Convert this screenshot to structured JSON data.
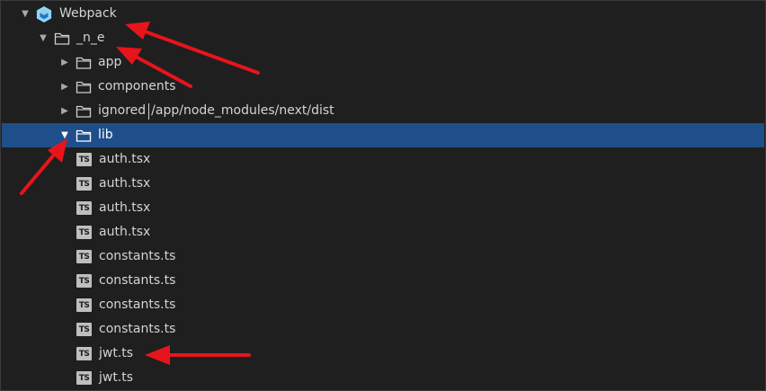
{
  "tree": {
    "root": {
      "label": "Webpack",
      "icon": "webpack-cube-icon",
      "expanded": true
    },
    "ne": {
      "label": "_n_e",
      "icon": "folder-icon",
      "expanded": true
    },
    "folders": [
      {
        "label": "app",
        "icon": "folder-icon",
        "expanded": false
      },
      {
        "label": "components",
        "icon": "folder-icon",
        "expanded": false
      },
      {
        "label": "ignored",
        "path": "/app/node_modules/next/dist",
        "icon": "folder-icon",
        "expanded": false
      }
    ],
    "lib": {
      "label": "lib",
      "icon": "folder-icon",
      "expanded": true,
      "selected": true
    },
    "files": [
      {
        "label": "auth.tsx",
        "badge": "TS"
      },
      {
        "label": "auth.tsx",
        "badge": "TS"
      },
      {
        "label": "auth.tsx",
        "badge": "TS"
      },
      {
        "label": "auth.tsx",
        "badge": "TS"
      },
      {
        "label": "constants.ts",
        "badge": "TS"
      },
      {
        "label": "constants.ts",
        "badge": "TS"
      },
      {
        "label": "constants.ts",
        "badge": "TS"
      },
      {
        "label": "constants.ts",
        "badge": "TS"
      },
      {
        "label": "jwt.ts",
        "badge": "TS"
      },
      {
        "label": "jwt.ts",
        "badge": "TS"
      }
    ]
  },
  "colors": {
    "background": "#1f1f1f",
    "selection": "#1f4f8a",
    "text": "#d4d4d4",
    "annotation_arrow": "#e8141b",
    "webpack_blue": "#8ed6fb"
  },
  "annotations": {
    "arrow_count": 5
  }
}
